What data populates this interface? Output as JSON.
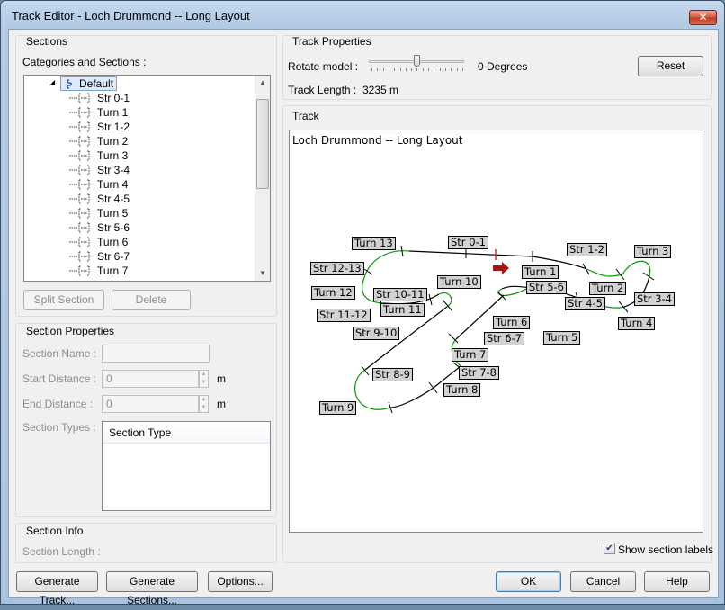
{
  "window": {
    "title": "Track Editor - Loch Drummond -- Long Layout",
    "close_label": "✕"
  },
  "sections_pane": {
    "header": "Sections",
    "tree_label": "Categories and Sections :",
    "root": "Default",
    "items": [
      "Str 0-1",
      "Turn 1",
      "Str 1-2",
      "Turn 2",
      "Turn 3",
      "Str 3-4",
      "Turn 4",
      "Str 4-5",
      "Turn 5",
      "Str 5-6",
      "Turn 6",
      "Str 6-7",
      "Turn 7"
    ],
    "split_button": "Split Section",
    "delete_button": "Delete"
  },
  "section_properties": {
    "header": "Section Properties",
    "name_label": "Section Name :",
    "name_value": "",
    "start_label": "Start Distance :",
    "start_value": "0",
    "start_unit": "m",
    "end_label": "End Distance :",
    "end_value": "0",
    "end_unit": "m",
    "types_label": "Section Types :",
    "types_column": "Section Type"
  },
  "section_info": {
    "header": "Section Info",
    "length_label": "Section Length :"
  },
  "track_properties": {
    "header": "Track Properties",
    "rotate_label": "Rotate model :",
    "rotate_value": "0 Degrees",
    "rotate_fraction": 0.5,
    "reset_button": "Reset",
    "length_label": "Track Length :",
    "length_value": "3235 m"
  },
  "track_view": {
    "header": "Track",
    "name": "Loch Drummond -- Long Layout",
    "labels": [
      "Str 0-1",
      "Turn 13",
      "Str 1-2",
      "Turn 3",
      "Str 12-13",
      "Turn 1",
      "Turn 12",
      "Turn 10",
      "Turn 2",
      "Str 10-11",
      "Str 5-6",
      "Str 3-4",
      "Str 4-5",
      "Turn 11",
      "Str 11-12",
      "Turn 6",
      "Turn 4",
      "Str 9-10",
      "Str 6-7",
      "Turn 5",
      "Turn 7",
      "Str 8-9",
      "Str 7-8",
      "Turn 8",
      "Turn 9"
    ]
  },
  "show_labels": {
    "label": "Show section labels",
    "checked": true
  },
  "buttons": {
    "generate_track": "Generate Track...",
    "generate_sections": "Generate Sections...",
    "options": "Options...",
    "ok": "OK",
    "cancel": "Cancel",
    "help": "Help"
  }
}
